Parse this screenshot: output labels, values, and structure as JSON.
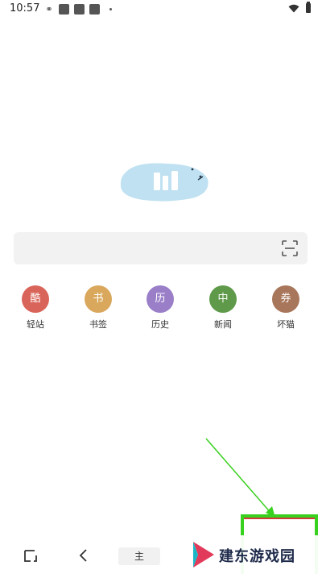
{
  "status_bar": {
    "time": "10:57"
  },
  "search": {
    "placeholder": ""
  },
  "shortcuts": [
    {
      "icon_char": "酷",
      "label": "轻站",
      "color": "#d9655a"
    },
    {
      "icon_char": "书",
      "label": "书签",
      "color": "#d9a85c"
    },
    {
      "icon_char": "历",
      "label": "历史",
      "color": "#9a7fc8"
    },
    {
      "icon_char": "中",
      "label": "新闻",
      "color": "#5f9a4a"
    },
    {
      "icon_char": "券",
      "label": "坏猫",
      "color": "#a8765a"
    }
  ],
  "toolbar": {
    "home_label": "主"
  },
  "watermark": {
    "text": "建东游戏园"
  },
  "colors": {
    "logo_blob": "#bfe1f1",
    "annotation": "#39d11f",
    "search_bg": "#f2f2f2"
  }
}
